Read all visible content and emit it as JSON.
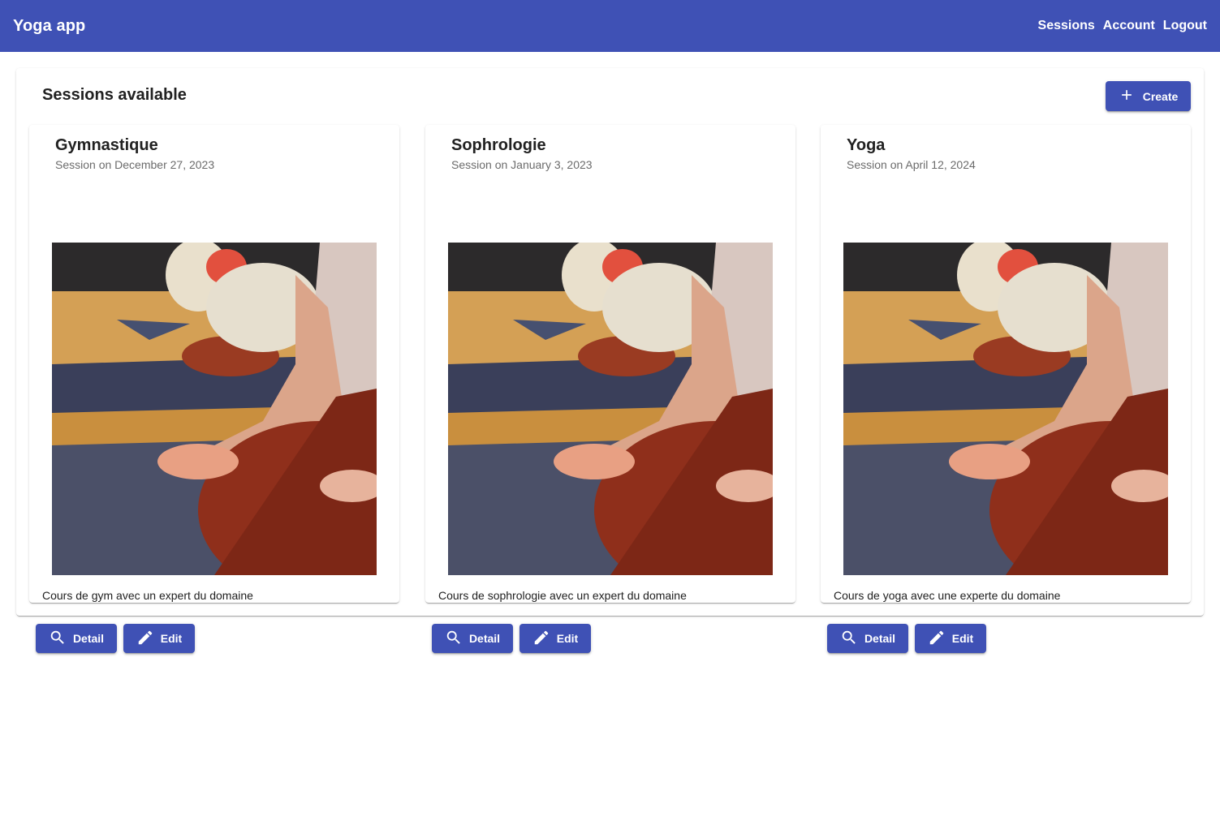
{
  "header": {
    "app_title": "Yoga app",
    "nav": [
      "Sessions",
      "Account",
      "Logout"
    ],
    "background": "#3f51b5"
  },
  "main": {
    "title": "Sessions available",
    "create_label": "Create",
    "create_icon": "plus-icon"
  },
  "sessions": [
    {
      "name": "Gymnastique",
      "date": "Session on December 27, 2023",
      "description": "Cours de gym avec un expert du domaine",
      "image": "yoga-class-photo",
      "detail_label": "Detail",
      "edit_label": "Edit"
    },
    {
      "name": "Sophrologie",
      "date": "Session on January 3, 2023",
      "description": "Cours de sophrologie avec un expert du domaine",
      "image": "yoga-class-photo",
      "detail_label": "Detail",
      "edit_label": "Edit"
    },
    {
      "name": "Yoga",
      "date": "Session on April 12, 2024",
      "description": "Cours de yoga avec une experte du domaine",
      "image": "yoga-class-photo",
      "detail_label": "Detail",
      "edit_label": "Edit"
    }
  ],
  "icons": {
    "detail": "search-icon",
    "edit": "pencil-icon"
  },
  "colors": {
    "primary": "#3f51b5",
    "subtitle": "#6b6b6b"
  }
}
